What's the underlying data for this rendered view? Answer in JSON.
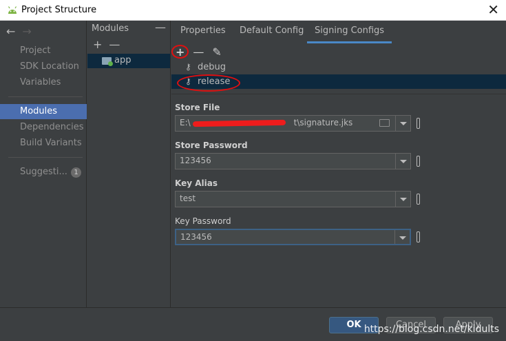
{
  "window": {
    "title": "Project Structure",
    "close_glyph": "✕"
  },
  "nav": {
    "back_glyph": "←",
    "forward_glyph": "→",
    "items": [
      "Project",
      "SDK Location",
      "Variables",
      "Modules",
      "Dependencies",
      "Build Variants",
      "Suggesti..."
    ],
    "active": "Modules",
    "suggestions_count": "1"
  },
  "modules": {
    "header": "Modules",
    "collapse_glyph": "—",
    "add_glyph": "+",
    "remove_glyph": "—",
    "items": [
      "app"
    ]
  },
  "tabs": [
    "Properties",
    "Default Config",
    "Signing Configs"
  ],
  "active_tab": "Signing Configs",
  "signing_toolbar": {
    "add_glyph": "+",
    "remove_glyph": "—",
    "edit_glyph": "✎"
  },
  "signing_configs": [
    "debug",
    "release"
  ],
  "selected_config": "release",
  "fields": {
    "store_file": {
      "label": "Store File",
      "value_prefix": "E:\\",
      "value_suffix": "t\\signature.jks"
    },
    "store_password": {
      "label": "Store Password",
      "value": "123456"
    },
    "key_alias": {
      "label": "Key Alias",
      "value": "test"
    },
    "key_password": {
      "label": "Key Password",
      "value": "123456"
    }
  },
  "buttons": {
    "ok": "OK",
    "cancel": "Cancel",
    "apply": "Apply"
  },
  "watermark": "https://blog.csdn.net/kidults",
  "colors": {
    "accent": "#4b6eaf",
    "selection": "#0d293e",
    "annotation": "#e01010"
  }
}
